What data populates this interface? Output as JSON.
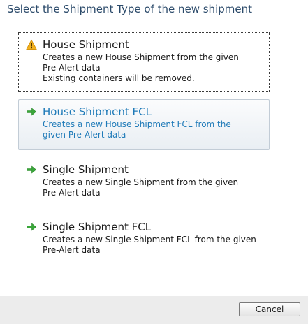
{
  "dialog": {
    "title": "Select the Shipment Type of the new shipment"
  },
  "options": [
    {
      "icon": "warning-icon",
      "title": "House Shipment",
      "desc": [
        "Creates a new House Shipment from the given",
        "Pre-Alert data",
        "Existing containers will be removed."
      ]
    },
    {
      "icon": "arrow-right-icon",
      "title": "House Shipment FCL",
      "desc": [
        "Creates a new House Shipment FCL from the",
        "given Pre-Alert data"
      ]
    },
    {
      "icon": "arrow-right-icon",
      "title": "Single Shipment",
      "desc": [
        "Creates a new Single Shipment from the given",
        "Pre-Alert data"
      ]
    },
    {
      "icon": "arrow-right-icon",
      "title": "Single Shipment FCL",
      "desc": [
        "Creates a new Single Shipment FCL from the given",
        "Pre-Alert data"
      ]
    }
  ],
  "footer": {
    "cancel_label": "Cancel"
  },
  "colors": {
    "title_text": "#2b4a6a",
    "hover_text": "#1e7ab8",
    "warning_fill": "#f2b01e",
    "arrow_green": "#3aa63a",
    "footer_bg": "#ececec"
  }
}
